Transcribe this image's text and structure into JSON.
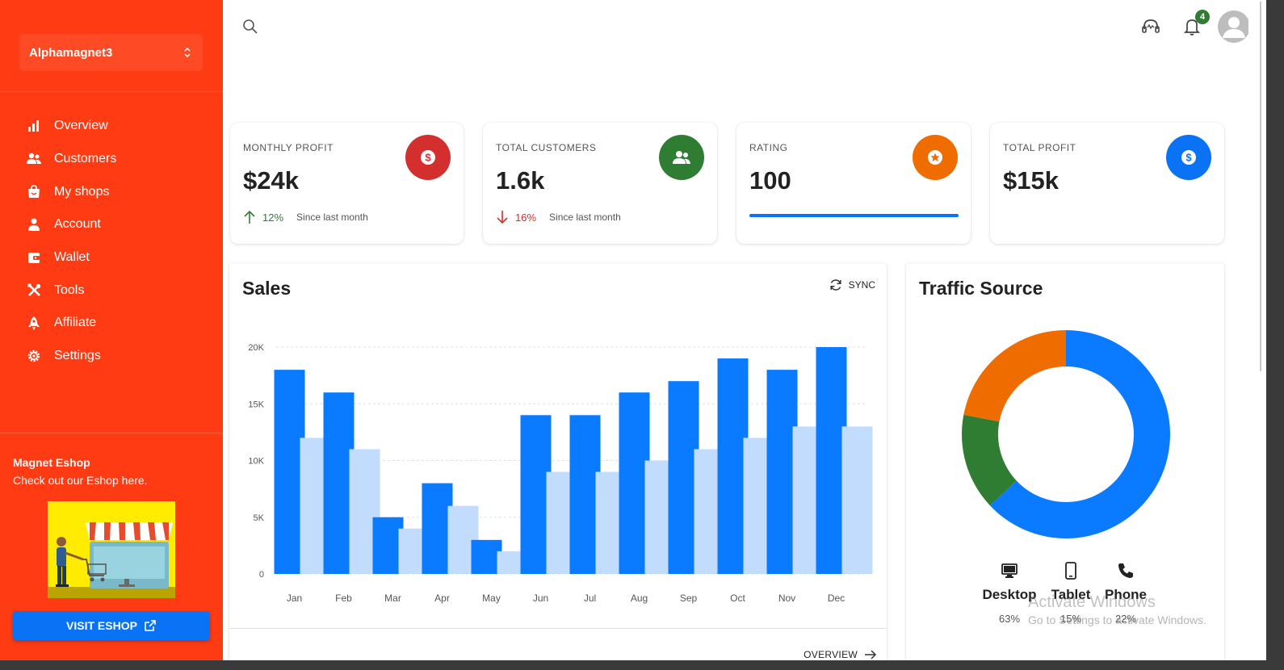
{
  "sidebar": {
    "org_name": "Alphamagnet3",
    "items": [
      {
        "label": "Overview",
        "icon": "bar-chart-icon"
      },
      {
        "label": "Customers",
        "icon": "users-icon"
      },
      {
        "label": "My shops",
        "icon": "shopping-bag-icon"
      },
      {
        "label": "Account",
        "icon": "user-icon"
      },
      {
        "label": "Wallet",
        "icon": "wallet-icon"
      },
      {
        "label": "Tools",
        "icon": "tools-icon"
      },
      {
        "label": "Affiliate",
        "icon": "rocket-icon"
      },
      {
        "label": "Settings",
        "icon": "gear-icon"
      }
    ],
    "promo": {
      "title": "Magnet Eshop",
      "text": "Check out our Eshop here.",
      "button_label": "VISIT ESHOP"
    }
  },
  "topbar": {
    "notification_count": "4"
  },
  "stats": [
    {
      "label": "MONTHLY PROFIT",
      "value": "$24k",
      "trend": "up",
      "trend_pct": "12%",
      "trend_text": "Since last month",
      "color": "#d32f2f",
      "icon": "dollar-icon"
    },
    {
      "label": "TOTAL CUSTOMERS",
      "value": "1.6k",
      "trend": "down",
      "trend_pct": "16%",
      "trend_text": "Since last month",
      "color": "#2e7d32",
      "icon": "users-icon"
    },
    {
      "label": "RATING",
      "value": "100",
      "color": "#ef6c00",
      "icon": "star-icon",
      "progress": 100
    },
    {
      "label": "TOTAL PROFIT",
      "value": "$15k",
      "color": "#0a72f5",
      "icon": "dollar-icon"
    }
  ],
  "sales": {
    "title": "Sales",
    "sync_label": "SYNC",
    "overview_label": "OVERVIEW"
  },
  "traffic": {
    "title": "Traffic Source",
    "items": [
      {
        "label": "Desktop",
        "pct": "63%",
        "icon": "desktop-icon"
      },
      {
        "label": "Tablet",
        "pct": "15%",
        "icon": "tablet-icon"
      },
      {
        "label": "Phone",
        "pct": "22%",
        "icon": "phone-icon"
      }
    ]
  },
  "watermark": {
    "line1": "Activate Windows",
    "line2": "Go to Settings to activate Windows."
  },
  "chart_data": [
    {
      "type": "bar",
      "categories": [
        "Jan",
        "Feb",
        "Mar",
        "Apr",
        "May",
        "Jun",
        "Jul",
        "Aug",
        "Sep",
        "Oct",
        "Nov",
        "Dec"
      ],
      "series": [
        {
          "values": [
            18,
            16,
            5,
            8,
            3,
            14,
            14,
            16,
            17,
            19,
            18,
            20
          ],
          "color": "#0a7bff"
        },
        {
          "values": [
            12,
            11,
            4,
            6,
            2,
            9,
            9,
            10,
            11,
            12,
            13,
            13
          ],
          "color": "#c2dcfd"
        }
      ],
      "ylim": [
        0,
        20
      ],
      "yticks": [
        0,
        5,
        10,
        15,
        20
      ],
      "ytick_labels": [
        "0",
        "5K",
        "10K",
        "15K",
        "20K"
      ],
      "grid": true,
      "title": "Sales"
    },
    {
      "type": "pie",
      "donut": true,
      "labels": [
        "Desktop",
        "Tablet",
        "Phone"
      ],
      "values": [
        63,
        15,
        22
      ],
      "colors": [
        "#0a7bff",
        "#2e7d32",
        "#ef6c00"
      ],
      "title": "Traffic Source"
    }
  ]
}
